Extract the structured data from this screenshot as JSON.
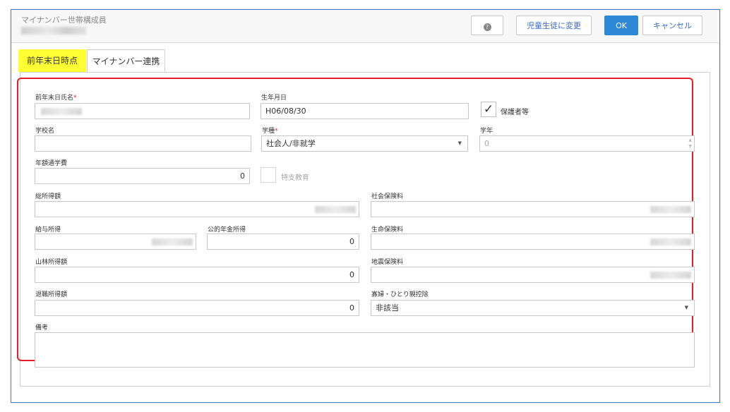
{
  "header": {
    "title": "マイナンバー世帯構成員",
    "help_icon": "help-icon",
    "change_button": "児童生徒に変更",
    "ok_button": "OK",
    "cancel_button": "キャンセル"
  },
  "tabs": [
    {
      "label": "前年末日時点",
      "active": true
    },
    {
      "label": "マイナンバー連携",
      "active": false
    }
  ],
  "form": {
    "prev_year_name": {
      "label": "前年末日氏名",
      "required": "*"
    },
    "birthdate": {
      "label": "生年月日",
      "value": "H06/08/30"
    },
    "guardian": {
      "label": "保護者等",
      "checked": "✓"
    },
    "school_name": {
      "label": "学校名",
      "value": ""
    },
    "school_type": {
      "label": "学種",
      "required": "*",
      "value": "社会人/非就学"
    },
    "grade": {
      "label": "学年",
      "value": "0"
    },
    "annual_tuition": {
      "label": "年額通学費",
      "value": "0"
    },
    "special_education": {
      "label": "特支教育"
    },
    "total_income": {
      "label": "総所得額"
    },
    "social_insurance": {
      "label": "社会保険料"
    },
    "salary_income": {
      "label": "給与所得"
    },
    "public_pension": {
      "label": "公的年金所得",
      "value": "0"
    },
    "life_insurance": {
      "label": "生命保険料"
    },
    "forest_income": {
      "label": "山林所得額",
      "value": "0"
    },
    "earthquake_insurance": {
      "label": "地震保険料"
    },
    "retirement_income": {
      "label": "退職所得額",
      "value": "0"
    },
    "widow_deduction": {
      "label": "寡婦・ひとり親控除",
      "value": "非該当"
    },
    "remarks": {
      "label": "備考",
      "value": ""
    }
  },
  "colors": {
    "accent": "#2f87d8",
    "highlight": "#ffff33",
    "required": "#e41e26",
    "window_border": "#3b7bd4"
  }
}
